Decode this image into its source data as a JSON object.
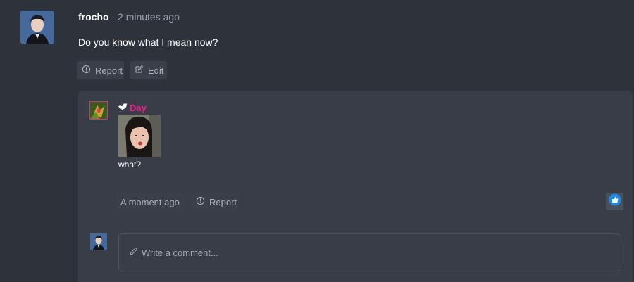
{
  "post": {
    "author": "frocho",
    "separator": "·",
    "timestamp": "2 minutes ago",
    "body": "Do you know what I mean now?",
    "actions": {
      "report": "Report",
      "edit": "Edit"
    }
  },
  "reply": {
    "author": "Day",
    "author_color": "#ee1f8c",
    "text": "what?",
    "timestamp": "A moment ago",
    "report": "Report"
  },
  "composer": {
    "placeholder": "Write a comment..."
  },
  "icons": {
    "report": "alert-circle-icon",
    "edit": "edit-icon",
    "bird": "bird-icon",
    "like": "thumbs-up-icon",
    "pencil": "pencil-icon"
  },
  "colors": {
    "background": "#2e323b",
    "panel": "#383d47",
    "like_accent": "#1e88e5"
  }
}
